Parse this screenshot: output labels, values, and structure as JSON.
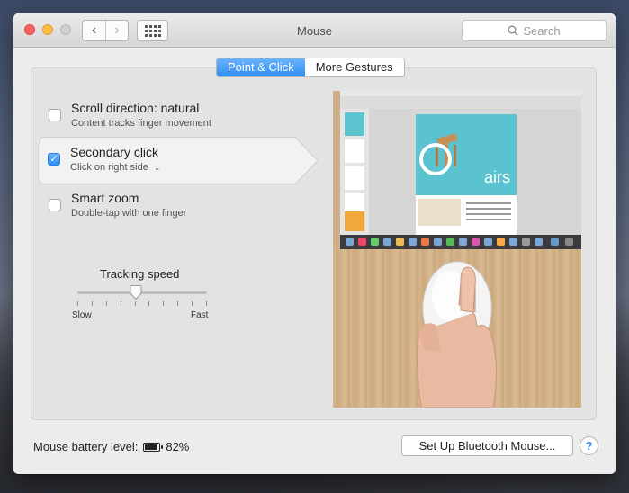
{
  "window": {
    "title": "Mouse"
  },
  "toolbar": {
    "back_glyph": "‹",
    "forward_glyph": "›",
    "search_placeholder": "Search"
  },
  "tabs": [
    {
      "label": "Point & Click",
      "active": true
    },
    {
      "label": "More Gestures",
      "active": false
    }
  ],
  "options": [
    {
      "title": "Scroll direction: natural",
      "subtitle": "Content tracks finger movement",
      "checked": false
    },
    {
      "title": "Secondary click",
      "subtitle": "Click on right side",
      "checked": true
    },
    {
      "title": "Smart zoom",
      "subtitle": "Double-tap with one finger",
      "checked": false
    }
  ],
  "tracking": {
    "label": "Tracking speed",
    "min_label": "Slow",
    "max_label": "Fast",
    "value": 0.45,
    "ticks": 10
  },
  "preview": {
    "doc_text": "airs"
  },
  "battery": {
    "label": "Mouse battery level:",
    "value": "82%",
    "level": 0.82
  },
  "buttons": {
    "bluetooth": "Set Up Bluetooth Mouse...",
    "help": "?"
  },
  "colors": {
    "accent": "#2f8ef3",
    "close": "#fc605c",
    "minimize": "#fdbc40"
  },
  "icons": {
    "search": "search-icon",
    "grid": "show-all-icon",
    "battery": "battery-icon"
  }
}
